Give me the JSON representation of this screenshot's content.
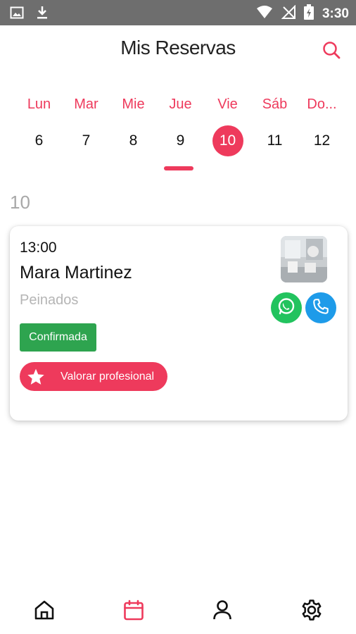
{
  "status_bar": {
    "time": "3:30",
    "icons": [
      "image-icon",
      "download-icon",
      "wifi-icon",
      "no-signal-icon",
      "battery-charging-icon"
    ]
  },
  "header": {
    "title": "Mis Reservas",
    "search_icon": "search-icon"
  },
  "week": {
    "days": [
      {
        "name": "Lun",
        "num": "6"
      },
      {
        "name": "Mar",
        "num": "7"
      },
      {
        "name": "Mie",
        "num": "8"
      },
      {
        "name": "Jue",
        "num": "9"
      },
      {
        "name": "Vie",
        "num": "10"
      },
      {
        "name": "Sáb",
        "num": "11"
      },
      {
        "name": "Do...",
        "num": "12"
      }
    ],
    "selected_day": "10"
  },
  "section": {
    "date_label": "10"
  },
  "booking": {
    "time": "13:00",
    "client": "Mara Martinez",
    "service": "Peinados",
    "status": "Confirmada",
    "rate_label": "Valorar profesional"
  },
  "colors": {
    "accent": "#ee3a5c",
    "confirmed": "#2ea44f",
    "whatsapp": "#22c35e",
    "call": "#1e9be9",
    "status_bar": "#6e6e6e"
  },
  "bottom_nav": {
    "items": [
      "home-icon",
      "calendar-icon",
      "user-icon",
      "settings-icon"
    ],
    "active": "calendar-icon"
  }
}
